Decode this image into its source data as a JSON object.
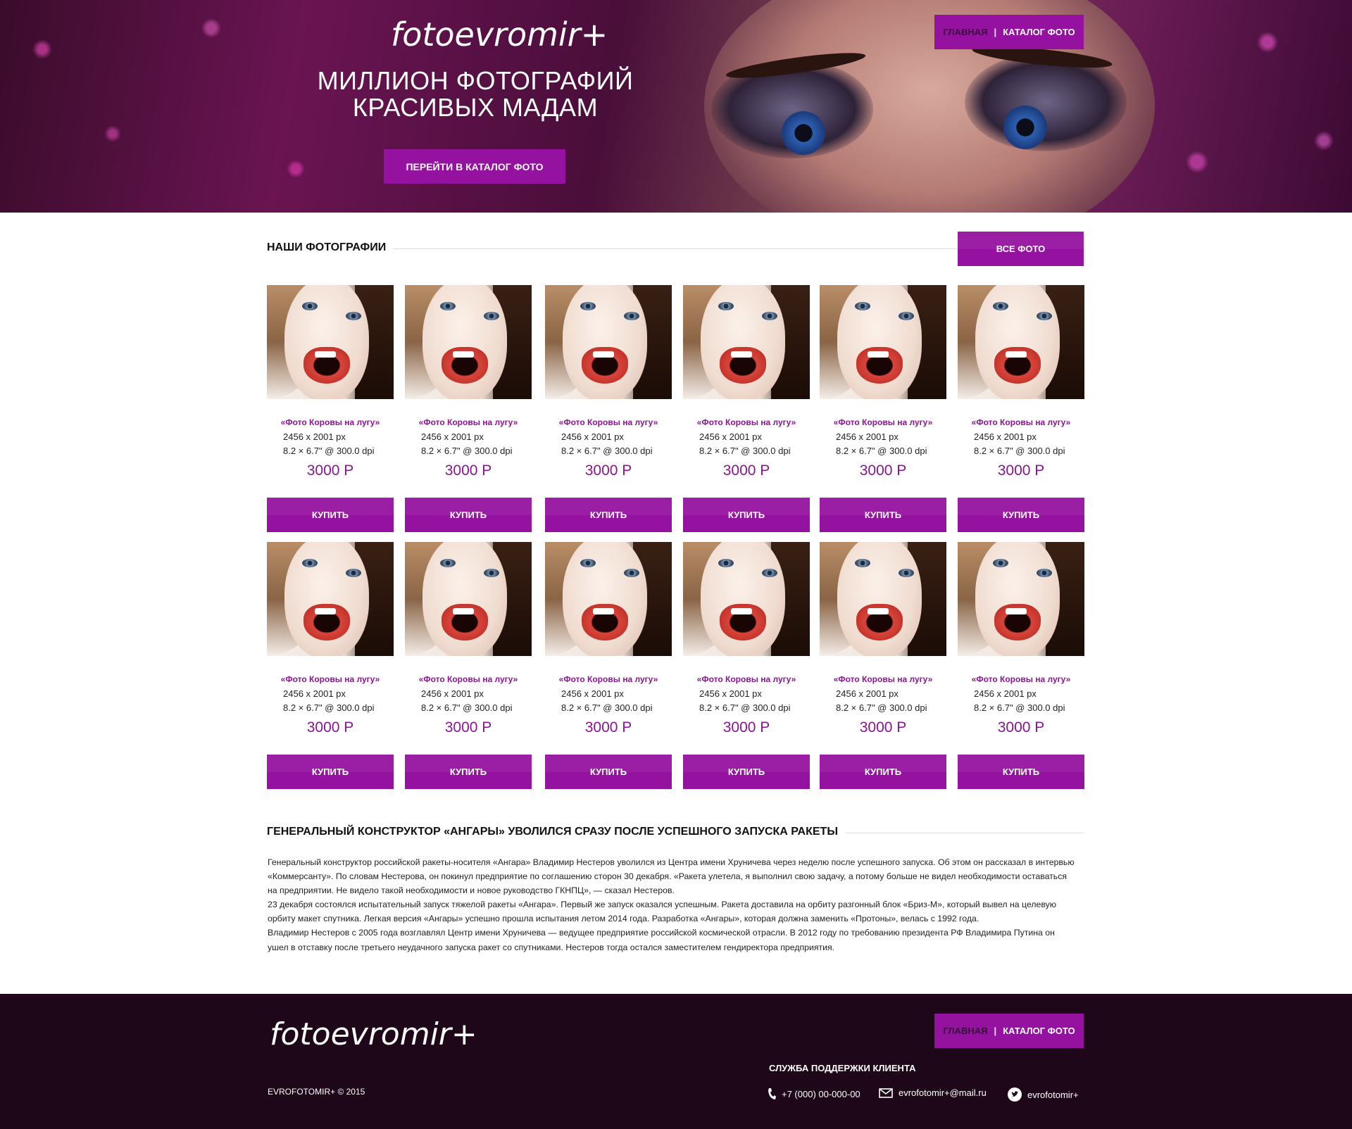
{
  "hero": {
    "logo": "fotoevromir+",
    "title_line1": "МИЛЛИОН ФОТОГРАФИЙ",
    "title_line2": "КРАСИВЫХ МАДАМ",
    "cta": "ПЕРЕЙТИ В КАТАЛОГ ФОТО"
  },
  "nav": {
    "home": "ГЛАВНАЯ",
    "separator": "|",
    "catalog": "КАТАЛОГ ФОТО"
  },
  "photos_section": {
    "title": "НАШИ ФОТОГРАФИИ",
    "all_button": "ВСЕ ФОТО",
    "cards": [
      {
        "title": "«Фото Коровы на лугу»",
        "dimensions": "2456 x 2001 px",
        "print_size": "8.2 × 6.7\" @ 300.0 dpi",
        "price": "3000 Р",
        "buy": "КУПИТЬ"
      },
      {
        "title": "«Фото Коровы на лугу»",
        "dimensions": "2456 x 2001 px",
        "print_size": "8.2 × 6.7\" @ 300.0 dpi",
        "price": "3000 Р",
        "buy": "КУПИТЬ"
      },
      {
        "title": "«Фото Коровы на лугу»",
        "dimensions": "2456 x 2001 px",
        "print_size": "8.2 × 6.7\" @ 300.0 dpi",
        "price": "3000 Р",
        "buy": "КУПИТЬ"
      },
      {
        "title": "«Фото Коровы на лугу»",
        "dimensions": "2456 x 2001 px",
        "print_size": "8.2 × 6.7\" @ 300.0 dpi",
        "price": "3000 Р",
        "buy": "КУПИТЬ"
      },
      {
        "title": "«Фото Коровы на лугу»",
        "dimensions": "2456 x 2001 px",
        "print_size": "8.2 × 6.7\" @ 300.0 dpi",
        "price": "3000 Р",
        "buy": "КУПИТЬ"
      },
      {
        "title": "«Фото Коровы на лугу»",
        "dimensions": "2456 x 2001 px",
        "print_size": "8.2 × 6.7\" @ 300.0 dpi",
        "price": "3000 Р",
        "buy": "КУПИТЬ"
      },
      {
        "title": "«Фото Коровы на лугу»",
        "dimensions": "2456 x 2001 px",
        "print_size": "8.2 × 6.7\" @ 300.0 dpi",
        "price": "3000 Р",
        "buy": "КУПИТЬ"
      },
      {
        "title": "«Фото Коровы на лугу»",
        "dimensions": "2456 x 2001 px",
        "print_size": "8.2 × 6.7\" @ 300.0 dpi",
        "price": "3000 Р",
        "buy": "КУПИТЬ"
      },
      {
        "title": "«Фото Коровы на лугу»",
        "dimensions": "2456 x 2001 px",
        "print_size": "8.2 × 6.7\" @ 300.0 dpi",
        "price": "3000 Р",
        "buy": "КУПИТЬ"
      },
      {
        "title": "«Фото Коровы на лугу»",
        "dimensions": "2456 x 2001 px",
        "print_size": "8.2 × 6.7\" @ 300.0 dpi",
        "price": "3000 Р",
        "buy": "КУПИТЬ"
      },
      {
        "title": "«Фото Коровы на лугу»",
        "dimensions": "2456 x 2001 px",
        "print_size": "8.2 × 6.7\" @ 300.0 dpi",
        "price": "3000 Р",
        "buy": "КУПИТЬ"
      },
      {
        "title": "«Фото Коровы на лугу»",
        "dimensions": "2456 x 2001 px",
        "print_size": "8.2 × 6.7\" @ 300.0 dpi",
        "price": "3000 Р",
        "buy": "КУПИТЬ"
      }
    ]
  },
  "article": {
    "title": "ГЕНЕРАЛЬНЫЙ КОНСТРУКТОР «АНГАРЫ» УВОЛИЛСЯ СРАЗУ ПОСЛЕ УСПЕШНОГО ЗАПУСКА РАКЕТЫ",
    "paragraphs": [
      "Генеральный конструктор российской ракеты-носителя «Ангара» Владимир Нестеров уволился из Центра имени Хруничева через неделю после успешного запуска. Об этом он рассказал в интервью «Коммерсанту». По словам Нестерова, он покинул предприятие по соглашению сторон 30 декабря. «Ракета улетела, я выполнил свою задачу, а потому больше не видел необходимости оставаться на предприятии. Не видело такой необходимости и новое руководство ГКНПЦ», — сказал Нестеров.",
      "23 декабря состоялся испытательный запуск тяжелой ракеты «Ангара». Первый же запуск оказался успешным. Ракета доставила на орбиту разгонный блок «Бриз-М», который вывел на целевую орбиту макет спутника. Легкая версия «Ангары» успешно прошла испытания летом 2014 года. Разработка «Ангары», которая должна заменить «Протоны», велась с 1992 года.",
      "Владимир Нестеров с 2005 года возглавлял Центр имени Хруничева — ведущее предприятие российской космической отрасли. В 2012 году по требованию президента РФ Владимира Путина он ушел в отставку после третьего неудачного запуска ракет со спутниками. Нестеров тогда остался заместителем гендиректора предприятия."
    ]
  },
  "footer": {
    "logo": "fotoevromir+",
    "copyright": "EVROFOTOMIR+ © 2015",
    "support_title": "СЛУЖБА ПОДДЕРЖКИ КЛИЕНТА",
    "phone": "+7 (000) 00-000-00",
    "email": "evrofotomir+@mail.ru",
    "twitter": "evrofotomir+",
    "icons": [
      "phone-icon",
      "mail-icon",
      "twitter-icon"
    ]
  },
  "colors": {
    "accent": "#9511a0",
    "accent_text": "#8a1592",
    "footer_bg": "#1d0718"
  }
}
